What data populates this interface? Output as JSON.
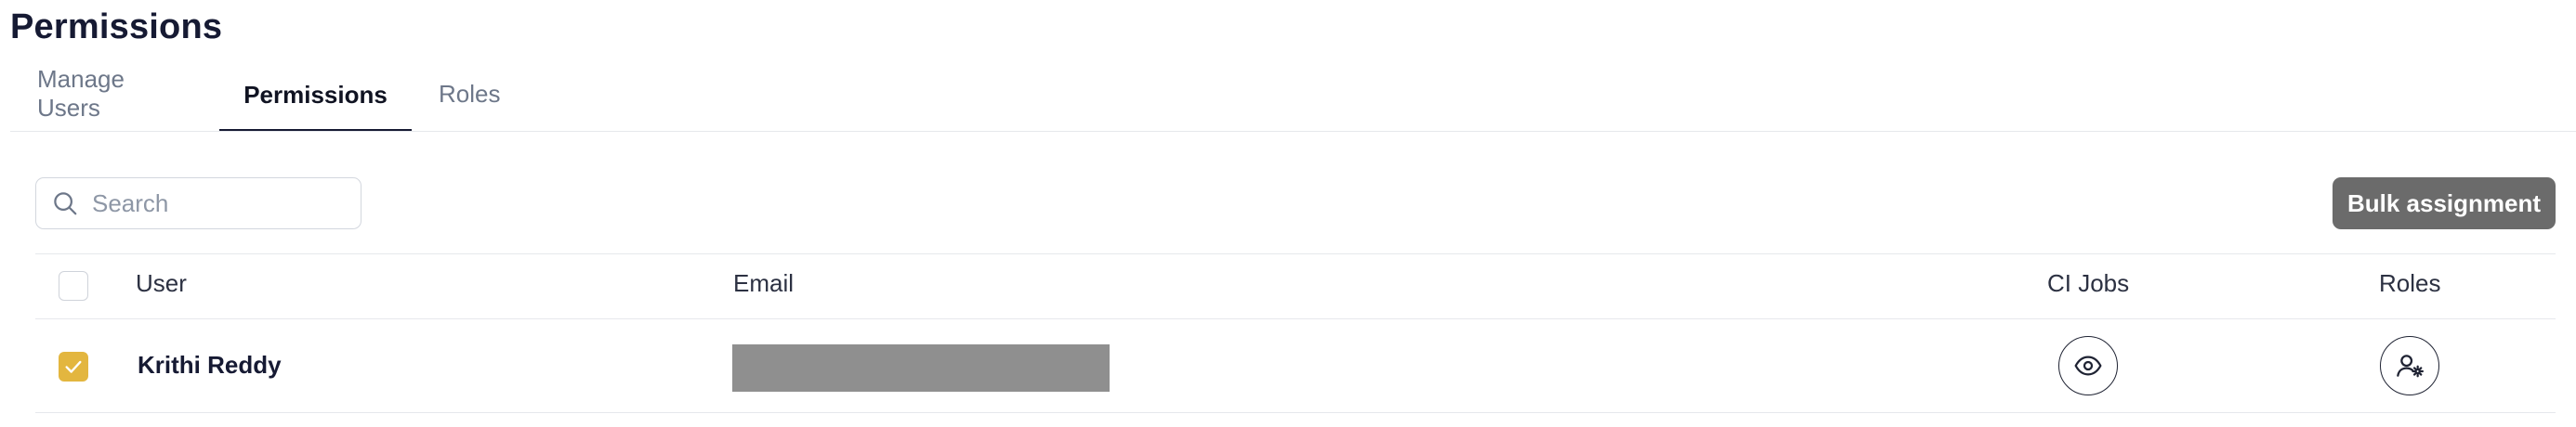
{
  "page": {
    "title": "Permissions"
  },
  "tabs": [
    {
      "label": "Manage Users",
      "active": false
    },
    {
      "label": "Permissions",
      "active": true
    },
    {
      "label": "Roles",
      "active": false
    }
  ],
  "toolbar": {
    "search_placeholder": "Search",
    "search_value": "",
    "bulk_assignment_label": "Bulk assignment"
  },
  "table": {
    "columns": [
      "User",
      "Email",
      "CI Jobs",
      "Roles"
    ],
    "header_checked": false,
    "rows": [
      {
        "user": "Krithi Reddy",
        "email_redacted": true,
        "checked": true,
        "ci_jobs_icon": "eye-icon",
        "roles_icon": "user-gear-icon"
      }
    ]
  },
  "colors": {
    "title": "#161a33",
    "checkbox_checked": "#e3b63f",
    "bulk_button_bg": "#6b6b6b",
    "redaction": "#8f8f8f"
  }
}
